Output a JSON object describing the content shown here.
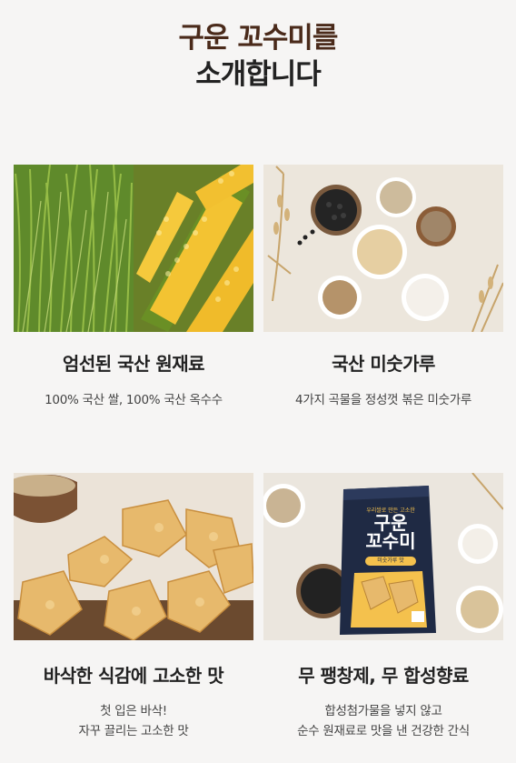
{
  "header": {
    "title_line1": "구운 꼬수미를",
    "title_line2": "소개합니다"
  },
  "features": [
    {
      "image": "rice-and-corn-photo",
      "heading": "엄선된 국산 원재료",
      "desc_line1": "100% 국산 쌀, 100% 국산 옥수수",
      "desc_line2": ""
    },
    {
      "image": "grain-bowls-photo",
      "heading": "국산 미숫가루",
      "desc_line1": "4가지 곡물을 정성껏 볶은 미숫가루",
      "desc_line2": ""
    },
    {
      "image": "crispy-snack-photo",
      "heading": "바삭한 식감에 고소한 맛",
      "desc_line1": "첫 입은 바삭!",
      "desc_line2": "자꾸 끌리는 고소한 맛"
    },
    {
      "image": "snack-package-photo",
      "heading": "무 팽창제, 무 합성향료",
      "desc_line1": "합성첨가물을 넣지 않고",
      "desc_line2": "순수 원재료로 맛을 낸 건강한 간식"
    }
  ],
  "package": {
    "brand_small": "우리쌀로 만든 고소한",
    "name_line1": "구운",
    "name_line2": "꼬수미",
    "badge": "미숫가루 맛"
  },
  "colors": {
    "background": "#f6f5f4",
    "title_brown": "#4a2a1a",
    "package_navy": "#1f2a44",
    "package_yellow": "#f4c14d"
  }
}
